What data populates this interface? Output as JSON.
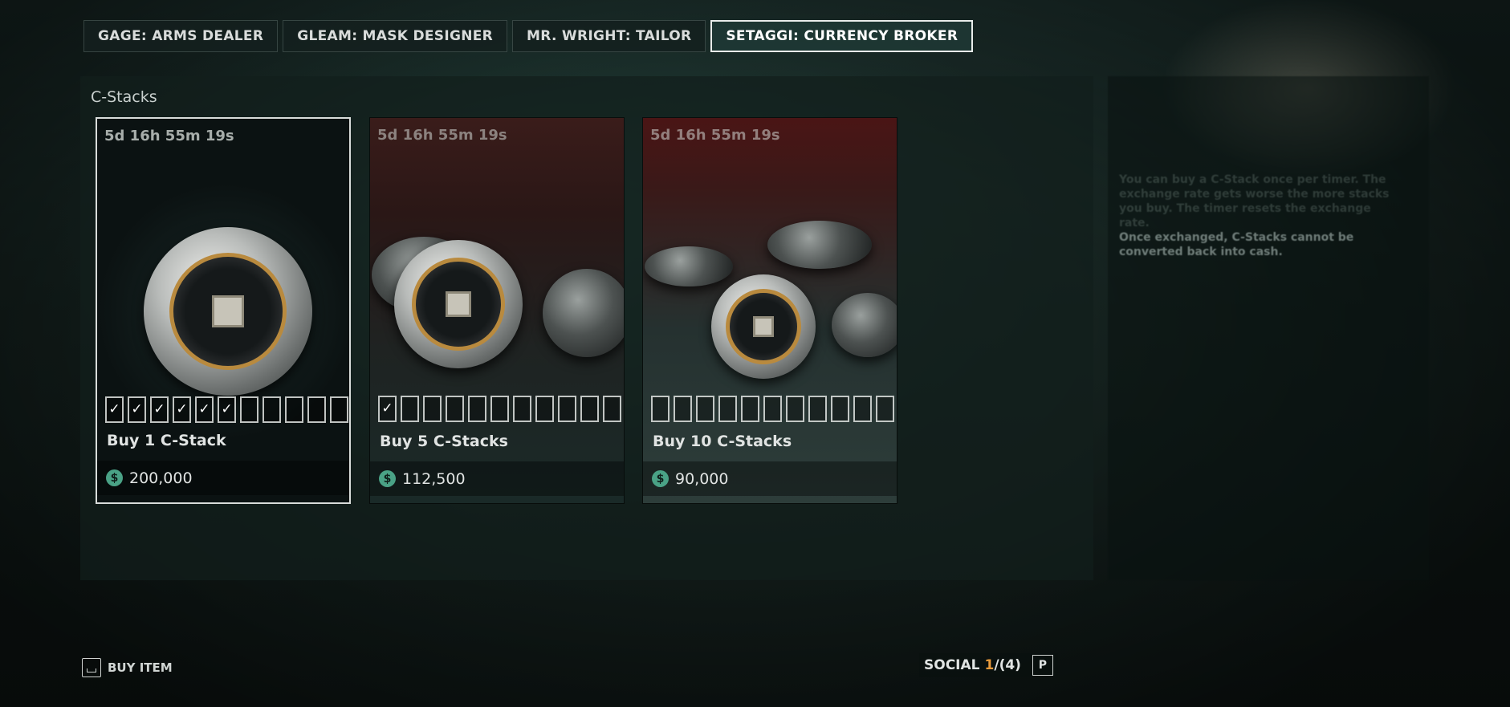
{
  "tabs": [
    {
      "label": "GAGE: ARMS DEALER",
      "active": false
    },
    {
      "label": "GLEAM: MASK DESIGNER",
      "active": false
    },
    {
      "label": "MR. WRIGHT: TAILOR",
      "active": false
    },
    {
      "label": "SETAGGI: CURRENCY BROKER",
      "active": true
    }
  ],
  "section_title": "C-Stacks",
  "cards": [
    {
      "timer": "5d 16h 55m 19s",
      "label": "Buy 1 C-Stack",
      "price": "200,000",
      "checked": 6,
      "total": 11,
      "selected": true
    },
    {
      "timer": "5d 16h 55m 19s",
      "label": "Buy 5 C-Stacks",
      "price": "112,500",
      "checked": 1,
      "total": 11,
      "selected": false
    },
    {
      "timer": "5d 16h 55m 19s",
      "label": "Buy 10 C-Stacks",
      "price": "90,000",
      "checked": 0,
      "total": 11,
      "selected": false
    }
  ],
  "currency_symbol": "$",
  "check_mark": "✓",
  "side_panel": {
    "faint_text": "You can buy a C-Stack once per timer. The exchange rate gets worse the more stacks you buy. The timer resets the exchange rate.",
    "note": "Once exchanged, C-Stacks cannot be converted back into cash."
  },
  "footer": {
    "buy_item": "BUY ITEM",
    "social_label": "SOCIAL",
    "social_online": "1",
    "social_sep": "/",
    "social_total": "(4)",
    "social_key": "P"
  },
  "colors": {
    "accent": "#4aa286",
    "online": "#e89a3b",
    "active_tab_border": "#e8ecea"
  }
}
